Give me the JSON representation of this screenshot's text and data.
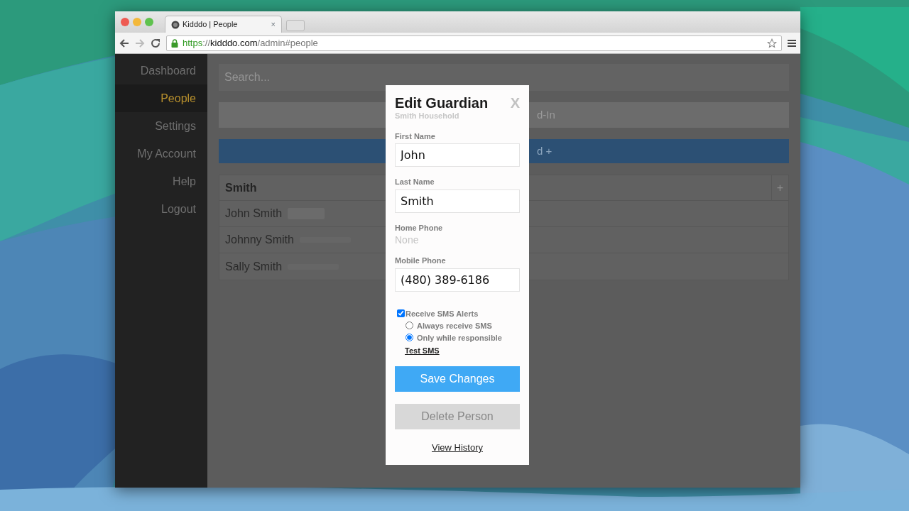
{
  "browser": {
    "tabs": [
      {
        "title": "Kidddo | People",
        "close": "×",
        "selected": true
      }
    ],
    "url": {
      "scheme": "https",
      "separator": "://",
      "host": "kidddo.com",
      "path": "/admin#people"
    }
  },
  "sidebar": {
    "items": [
      {
        "label": "Dashboard",
        "selected": false
      },
      {
        "label": "People",
        "selected": true
      },
      {
        "label": "Settings",
        "selected": false
      },
      {
        "label": "My Account",
        "selected": false
      },
      {
        "label": "Help",
        "selected": false
      },
      {
        "label": "Logout",
        "selected": false
      }
    ]
  },
  "main": {
    "search": {
      "placeholder": "Search..."
    },
    "checkin_button": "d-In",
    "add_button": "d +",
    "household": {
      "name": "Smith",
      "add": "+",
      "members": [
        {
          "name": "John Smith",
          "kind": "guardian"
        },
        {
          "name": "Johnny Smith",
          "kind": "child"
        },
        {
          "name": "Sally Smith",
          "kind": "child"
        }
      ]
    }
  },
  "modal": {
    "title": "Edit Guardian",
    "close": "X",
    "subtitle": "Smith Household",
    "fields": [
      {
        "label": "First Name",
        "kind": "input",
        "value": "John"
      },
      {
        "label": "Last Name",
        "kind": "input",
        "value": "Smith"
      },
      {
        "label": "Home Phone",
        "kind": "text",
        "value": "None"
      },
      {
        "label": "Mobile Phone",
        "kind": "input",
        "value": "(480) 389-6186"
      }
    ],
    "sms": {
      "label": "Receive SMS Alerts",
      "checked": true,
      "options": [
        {
          "label": "Always receive SMS",
          "selected": false
        },
        {
          "label": "Only while responsible",
          "selected": true
        }
      ],
      "test_link": "Test SMS"
    },
    "save_button": "Save Changes",
    "delete_button": "Delete Person",
    "history_link": "View History"
  }
}
